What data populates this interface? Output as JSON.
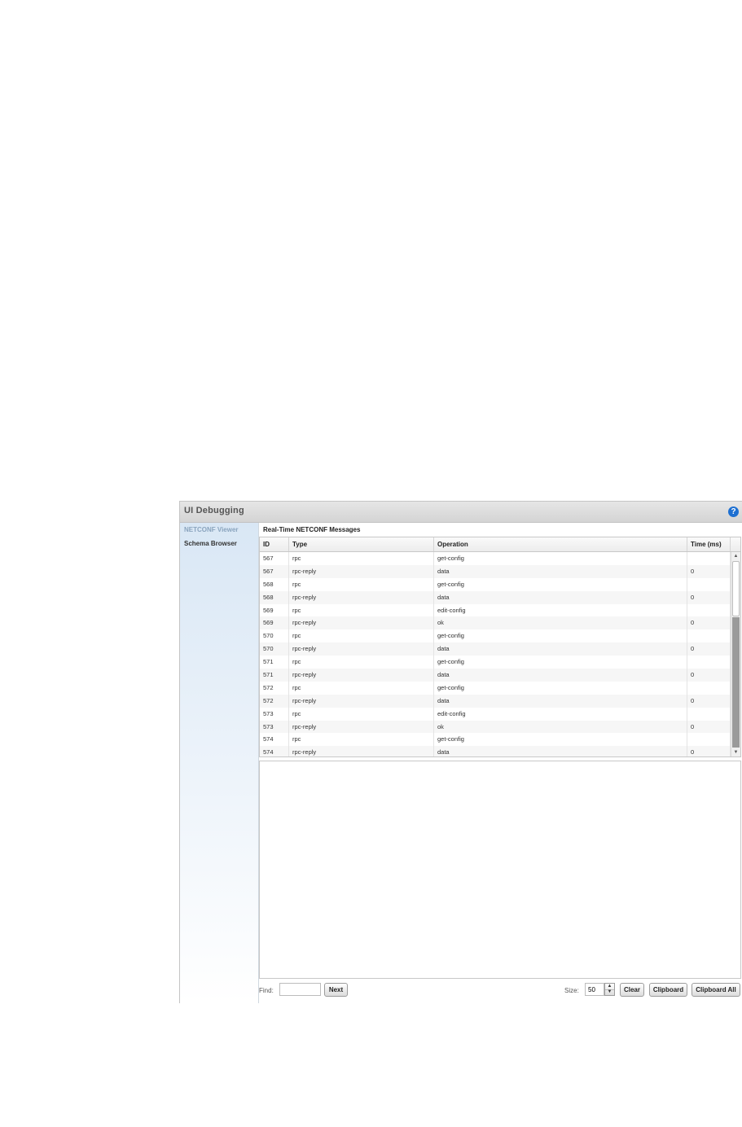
{
  "window": {
    "title": "UI Debugging",
    "help_icon": "?"
  },
  "sidebar": {
    "items": [
      {
        "label": "NETCONF Viewer",
        "active": true
      },
      {
        "label": "Schema Browser",
        "active": false
      }
    ]
  },
  "main": {
    "section_title": "Real-Time NETCONF Messages",
    "columns": [
      "ID",
      "Type",
      "Operation",
      "Time (ms)"
    ],
    "rows": [
      {
        "id": "567",
        "type": "rpc",
        "operation": "get-config",
        "time": ""
      },
      {
        "id": "567",
        "type": "rpc-reply",
        "operation": "data",
        "time": "0"
      },
      {
        "id": "568",
        "type": "rpc",
        "operation": "get-config",
        "time": ""
      },
      {
        "id": "568",
        "type": "rpc-reply",
        "operation": "data",
        "time": "0"
      },
      {
        "id": "569",
        "type": "rpc",
        "operation": "edit-config",
        "time": ""
      },
      {
        "id": "569",
        "type": "rpc-reply",
        "operation": "ok",
        "time": "0"
      },
      {
        "id": "570",
        "type": "rpc",
        "operation": "get-config",
        "time": ""
      },
      {
        "id": "570",
        "type": "rpc-reply",
        "operation": "data",
        "time": "0"
      },
      {
        "id": "571",
        "type": "rpc",
        "operation": "get-config",
        "time": ""
      },
      {
        "id": "571",
        "type": "rpc-reply",
        "operation": "data",
        "time": "0"
      },
      {
        "id": "572",
        "type": "rpc",
        "operation": "get-config",
        "time": ""
      },
      {
        "id": "572",
        "type": "rpc-reply",
        "operation": "data",
        "time": "0"
      },
      {
        "id": "573",
        "type": "rpc",
        "operation": "edit-config",
        "time": ""
      },
      {
        "id": "573",
        "type": "rpc-reply",
        "operation": "ok",
        "time": "0"
      },
      {
        "id": "574",
        "type": "rpc",
        "operation": "get-config",
        "time": ""
      },
      {
        "id": "574",
        "type": "rpc-reply",
        "operation": "data",
        "time": "0"
      }
    ]
  },
  "toolbar": {
    "find_label": "Find:",
    "find_value": "",
    "next_label": "Next",
    "size_label": "Size:",
    "size_value": "50",
    "clear_label": "Clear",
    "clipboard_label": "Clipboard",
    "clipboard_all_label": "Clipboard All"
  },
  "colors": {
    "help_icon": "#1d6fd1",
    "sidebar_active": "#8aa4be"
  }
}
